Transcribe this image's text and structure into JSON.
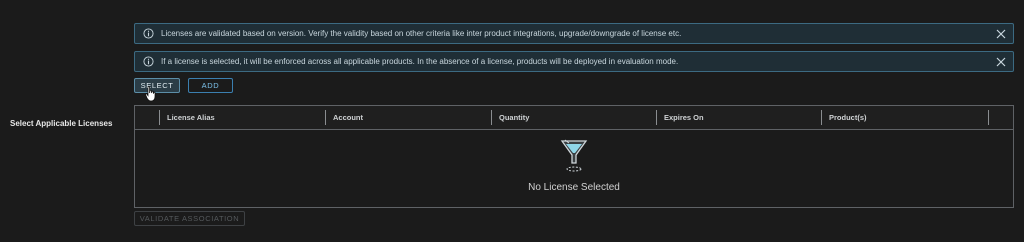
{
  "alerts": [
    {
      "text": "Licenses are validated based on version. Verify the validity based on other criteria like inter product integrations, upgrade/downgrade of license etc.",
      "icon": "info-icon",
      "close_icon": "close-icon"
    },
    {
      "text": "If a license is selected, it will be enforced across all applicable products. In the absence of a license, products will be deployed in evaluation mode.",
      "icon": "info-icon",
      "close_icon": "close-icon"
    }
  ],
  "actions": {
    "select_label": "SELECT",
    "add_label": "ADD"
  },
  "field_label": "Select Applicable Licenses",
  "grid": {
    "columns": [
      "License Alias",
      "Account",
      "Quantity",
      "Expires On",
      "Product(s)"
    ],
    "empty_icon": "empty-funnel-icon",
    "empty_text": "No License Selected"
  },
  "validate_label": "VALIDATE ASSOCIATION",
  "colors": {
    "background": "#1b1b1b",
    "alert_background": "#1f2e36",
    "alert_border": "#3c6a82",
    "link_blue": "#7cc1ea",
    "disabled": "#55595c"
  }
}
